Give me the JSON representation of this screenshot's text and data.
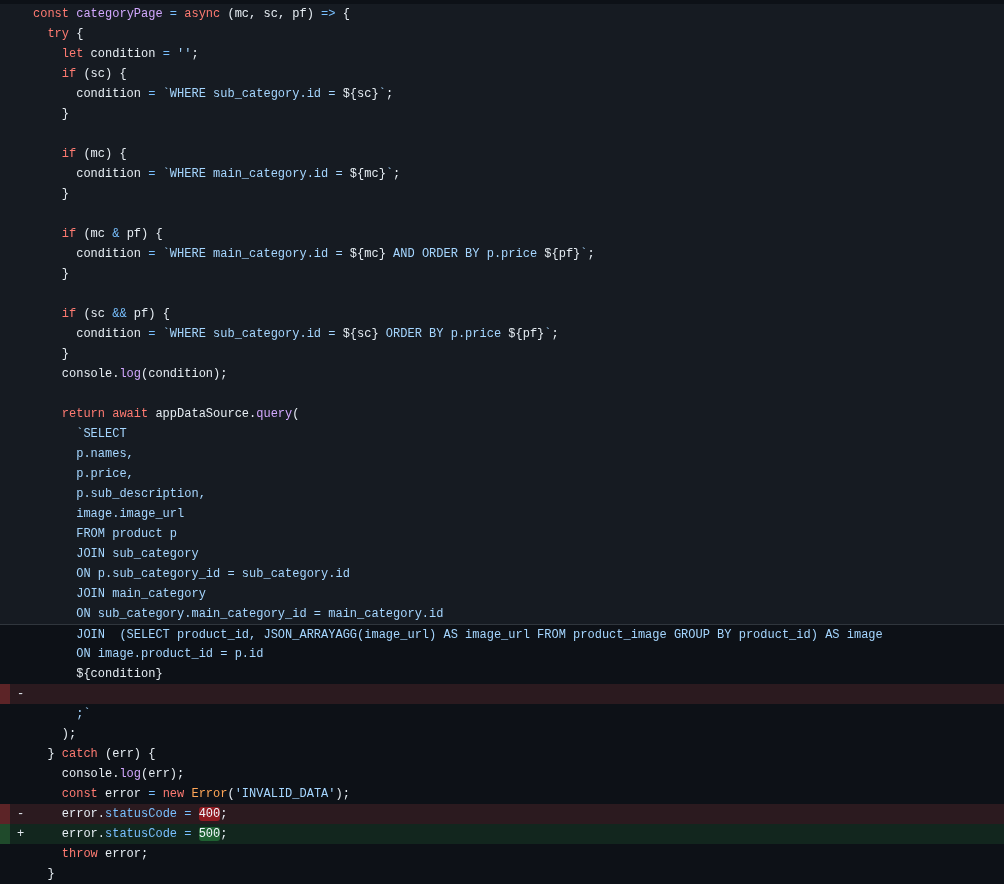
{
  "diff": {
    "lines": [
      {
        "kind": "expanded",
        "tokens": [
          {
            "kind": "keyword",
            "text": "const "
          },
          {
            "kind": "function",
            "text": "categoryPage "
          },
          {
            "kind": "operator",
            "text": "= "
          },
          {
            "kind": "keyword",
            "text": "async "
          },
          {
            "kind": "plain",
            "text": "(mc, sc, pf) "
          },
          {
            "kind": "operator",
            "text": "=> "
          },
          {
            "kind": "plain",
            "text": "{"
          }
        ]
      },
      {
        "kind": "expanded",
        "tokens": [
          {
            "kind": "keyword",
            "text": "  try"
          },
          {
            "kind": "plain",
            "text": " {"
          }
        ]
      },
      {
        "kind": "expanded",
        "tokens": [
          {
            "kind": "keyword",
            "text": "    let"
          },
          {
            "kind": "plain",
            "text": " condition "
          },
          {
            "kind": "operator",
            "text": "= "
          },
          {
            "kind": "string",
            "text": "''"
          },
          {
            "kind": "plain",
            "text": ";"
          }
        ]
      },
      {
        "kind": "expanded",
        "tokens": [
          {
            "kind": "keyword",
            "text": "    if"
          },
          {
            "kind": "plain",
            "text": " (sc) {"
          }
        ]
      },
      {
        "kind": "expanded",
        "tokens": [
          {
            "kind": "plain",
            "text": "      condition "
          },
          {
            "kind": "operator",
            "text": "= "
          },
          {
            "kind": "string",
            "text": "`WHERE sub_category.id = "
          },
          {
            "kind": "plain",
            "text": "${sc}"
          },
          {
            "kind": "string",
            "text": "`"
          },
          {
            "kind": "plain",
            "text": ";"
          }
        ]
      },
      {
        "kind": "expanded",
        "tokens": [
          {
            "kind": "plain",
            "text": "    }"
          }
        ]
      },
      {
        "kind": "expanded"
      },
      {
        "kind": "expanded",
        "tokens": [
          {
            "kind": "keyword",
            "text": "    if"
          },
          {
            "kind": "plain",
            "text": " (mc) {"
          }
        ]
      },
      {
        "kind": "expanded",
        "tokens": [
          {
            "kind": "plain",
            "text": "      condition "
          },
          {
            "kind": "operator",
            "text": "= "
          },
          {
            "kind": "string",
            "text": "`WHERE main_category.id = "
          },
          {
            "kind": "plain",
            "text": "${mc}"
          },
          {
            "kind": "string",
            "text": "`"
          },
          {
            "kind": "plain",
            "text": ";"
          }
        ]
      },
      {
        "kind": "expanded",
        "tokens": [
          {
            "kind": "plain",
            "text": "    }"
          }
        ]
      },
      {
        "kind": "expanded"
      },
      {
        "kind": "expanded",
        "tokens": [
          {
            "kind": "keyword",
            "text": "    if"
          },
          {
            "kind": "plain",
            "text": " (mc "
          },
          {
            "kind": "operator",
            "text": "&"
          },
          {
            "kind": "plain",
            "text": " pf) {"
          }
        ]
      },
      {
        "kind": "expanded",
        "tokens": [
          {
            "kind": "plain",
            "text": "      condition "
          },
          {
            "kind": "operator",
            "text": "= "
          },
          {
            "kind": "string",
            "text": "`WHERE main_category.id = "
          },
          {
            "kind": "plain",
            "text": "${mc}"
          },
          {
            "kind": "string",
            "text": " AND ORDER BY p.price "
          },
          {
            "kind": "plain",
            "text": "${pf}"
          },
          {
            "kind": "string",
            "text": "`"
          },
          {
            "kind": "plain",
            "text": ";"
          }
        ]
      },
      {
        "kind": "expanded",
        "tokens": [
          {
            "kind": "plain",
            "text": "    }"
          }
        ]
      },
      {
        "kind": "expanded"
      },
      {
        "kind": "expanded",
        "tokens": [
          {
            "kind": "keyword",
            "text": "    if"
          },
          {
            "kind": "plain",
            "text": " (sc "
          },
          {
            "kind": "operator",
            "text": "&&"
          },
          {
            "kind": "plain",
            "text": " pf) {"
          }
        ]
      },
      {
        "kind": "expanded",
        "tokens": [
          {
            "kind": "plain",
            "text": "      condition "
          },
          {
            "kind": "operator",
            "text": "= "
          },
          {
            "kind": "string",
            "text": "`WHERE sub_category.id = "
          },
          {
            "kind": "plain",
            "text": "${sc}"
          },
          {
            "kind": "string",
            "text": " ORDER BY p.price "
          },
          {
            "kind": "plain",
            "text": "${pf}"
          },
          {
            "kind": "string",
            "text": "`"
          },
          {
            "kind": "plain",
            "text": ";"
          }
        ]
      },
      {
        "kind": "expanded",
        "tokens": [
          {
            "kind": "plain",
            "text": "    }"
          }
        ]
      },
      {
        "kind": "expanded",
        "tokens": [
          {
            "kind": "plain",
            "text": "    console."
          },
          {
            "kind": "function",
            "text": "log"
          },
          {
            "kind": "plain",
            "text": "(condition);"
          }
        ]
      },
      {
        "kind": "expanded"
      },
      {
        "kind": "expanded",
        "tokens": [
          {
            "kind": "keyword",
            "text": "    return await"
          },
          {
            "kind": "plain",
            "text": " appDataSource."
          },
          {
            "kind": "function",
            "text": "query"
          },
          {
            "kind": "plain",
            "text": "("
          }
        ]
      },
      {
        "kind": "expanded",
        "tokens": [
          {
            "kind": "string",
            "text": "      `SELECT"
          }
        ]
      },
      {
        "kind": "expanded",
        "tokens": [
          {
            "kind": "string",
            "text": "      p.names,"
          }
        ]
      },
      {
        "kind": "expanded",
        "tokens": [
          {
            "kind": "string",
            "text": "      p.price,"
          }
        ]
      },
      {
        "kind": "expanded",
        "tokens": [
          {
            "kind": "string",
            "text": "      p.sub_description,"
          }
        ]
      },
      {
        "kind": "expanded",
        "tokens": [
          {
            "kind": "string",
            "text": "      image.image_url"
          }
        ]
      },
      {
        "kind": "expanded",
        "tokens": [
          {
            "kind": "string",
            "text": "      FROM product p"
          }
        ]
      },
      {
        "kind": "expanded",
        "tokens": [
          {
            "kind": "string",
            "text": "      JOIN sub_category"
          }
        ]
      },
      {
        "kind": "expanded",
        "tokens": [
          {
            "kind": "string",
            "text": "      ON p.sub_category_id = sub_category.id"
          }
        ]
      },
      {
        "kind": "expanded",
        "tokens": [
          {
            "kind": "string",
            "text": "      JOIN main_category"
          }
        ]
      },
      {
        "kind": "expanded",
        "tokens": [
          {
            "kind": "string",
            "text": "      ON sub_category.main_category_id = main_category.id"
          }
        ]
      },
      {
        "kind": "context",
        "tokens": [
          {
            "kind": "string",
            "text": "      JOIN  (SELECT product_id, JSON_ARRAYAGG(image_url) AS image_url FROM product_image GROUP BY product_id) AS image"
          }
        ]
      },
      {
        "kind": "context",
        "tokens": [
          {
            "kind": "string",
            "text": "      ON image.product_id = p.id"
          }
        ]
      },
      {
        "kind": "context",
        "tokens": [
          {
            "kind": "plain",
            "text": "      ${condition}"
          }
        ]
      },
      {
        "kind": "removed",
        "marker": "-"
      },
      {
        "kind": "context",
        "tokens": [
          {
            "kind": "string",
            "text": "      ;`"
          }
        ]
      },
      {
        "kind": "context",
        "tokens": [
          {
            "kind": "plain",
            "text": "    );"
          }
        ]
      },
      {
        "kind": "context",
        "tokens": [
          {
            "kind": "plain",
            "text": "  } "
          },
          {
            "kind": "keyword",
            "text": "catch"
          },
          {
            "kind": "plain",
            "text": " (err) {"
          }
        ]
      },
      {
        "kind": "context",
        "tokens": [
          {
            "kind": "plain",
            "text": "    console."
          },
          {
            "kind": "function",
            "text": "log"
          },
          {
            "kind": "plain",
            "text": "(err);"
          }
        ]
      },
      {
        "kind": "context",
        "tokens": [
          {
            "kind": "keyword",
            "text": "    const"
          },
          {
            "kind": "plain",
            "text": " error "
          },
          {
            "kind": "operator",
            "text": "= "
          },
          {
            "kind": "keyword",
            "text": "new "
          },
          {
            "kind": "class",
            "text": "Error"
          },
          {
            "kind": "plain",
            "text": "("
          },
          {
            "kind": "string",
            "text": "'INVALID_DATA'"
          },
          {
            "kind": "plain",
            "text": ");"
          }
        ]
      },
      {
        "kind": "removed",
        "marker": "-",
        "tokens": [
          {
            "kind": "plain",
            "text": "    error."
          },
          {
            "kind": "operator",
            "text": "statusCode = "
          },
          {
            "kind": "deleted",
            "text": "400"
          },
          {
            "kind": "plain",
            "text": ";"
          }
        ]
      },
      {
        "kind": "added",
        "marker": "+",
        "tokens": [
          {
            "kind": "plain",
            "text": "    error."
          },
          {
            "kind": "operator",
            "text": "statusCode = "
          },
          {
            "kind": "inserted",
            "text": "500"
          },
          {
            "kind": "plain",
            "text": ";"
          }
        ]
      },
      {
        "kind": "context",
        "tokens": [
          {
            "kind": "keyword",
            "text": "    throw"
          },
          {
            "kind": "plain",
            "text": " error;"
          }
        ]
      },
      {
        "kind": "context",
        "tokens": [
          {
            "kind": "plain",
            "text": "  }"
          }
        ]
      }
    ]
  }
}
